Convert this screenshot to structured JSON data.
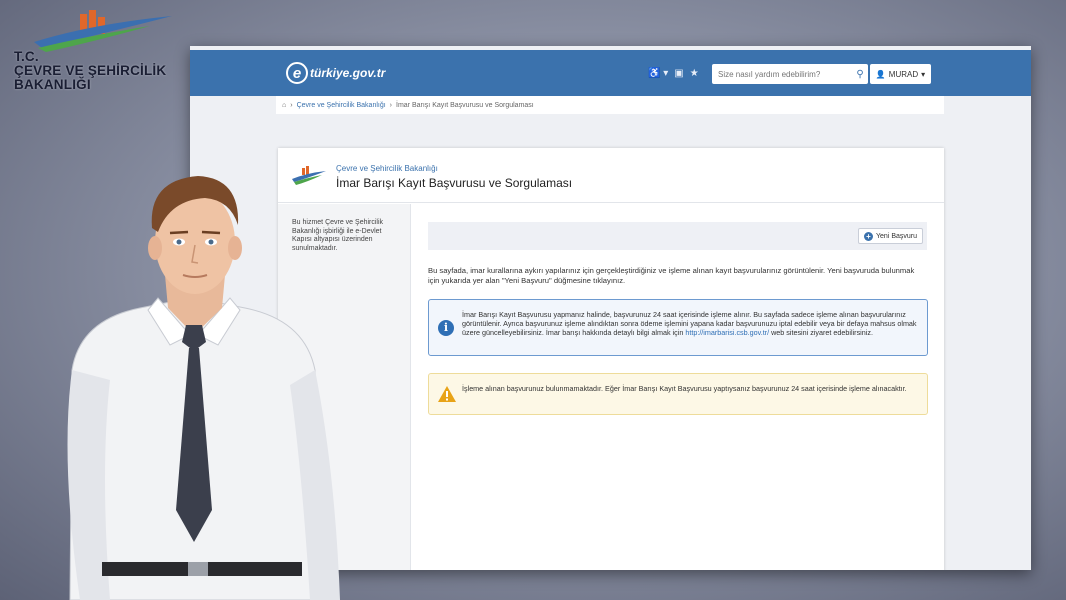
{
  "ministry": {
    "line1": "T.C.",
    "line2": "ÇEVRE VE ŞEHİRCİLİK",
    "line3": "BAKANLIĞI"
  },
  "portal": {
    "logo_text": "türkiye.gov.tr",
    "logo_letter": "e"
  },
  "header": {
    "search_placeholder": "Size nasıl yardım edebilirim?",
    "user_name": "MURAD"
  },
  "breadcrumb": {
    "items": [
      "Çevre ve Şehircilik Bakanlığı",
      "İmar Barışı Kayıt Başvurusu ve Sorgulaması"
    ]
  },
  "service": {
    "org": "Çevre ve Şehircilik Bakanlığı",
    "title": "İmar Barışı Kayıt Başvurusu ve Sorgulaması"
  },
  "sidebar": {
    "note": "Bu hizmet Çevre ve Şehircilik Bakanlığı işbirliği ile e-Devlet Kapısı altyapısı üzerinden sunulmaktadır."
  },
  "toolbar": {
    "new_label": "Yeni Başvuru"
  },
  "intro": "Bu sayfada, imar kurallarına aykırı yapılarınız için gerçekleştirdiğiniz ve işleme alınan kayıt başvurularınız görüntülenir. Yeni başvuruda bulunmak için yukarıda yer alan \"Yeni Başvuru\" düğmesine tıklayınız.",
  "info": {
    "text": "İmar Barışı Kayıt Başvurusu yapmanız halinde, başvurunuz 24 saat içerisinde işleme alınır. Bu sayfada sadece işleme alınan başvurularınız görüntülenir. Ayrıca başvurunuz işleme alındıktan sonra ödeme işlemini yapana kadar başvurunuzu iptal edebilir veya bir defaya mahsus olmak üzere güncelleyebilirsiniz. İmar barışı hakkında detaylı bilgi almak için",
    "link": "http://imarbarisi.csb.gov.tr/",
    "suffix": " web sitesini ziyaret edebilirsiniz."
  },
  "warning": {
    "text": "İşleme alınan başvurunuz bulunmamaktadır. Eğer İmar Barışı Kayıt Başvurusu yaptıysanız başvurunuz 24 saat içerisinde işleme alınacaktır."
  },
  "colors": {
    "header_blue": "#3b72ad",
    "info_border": "#6d9ad0",
    "warn_bg": "#fdf8e6"
  }
}
